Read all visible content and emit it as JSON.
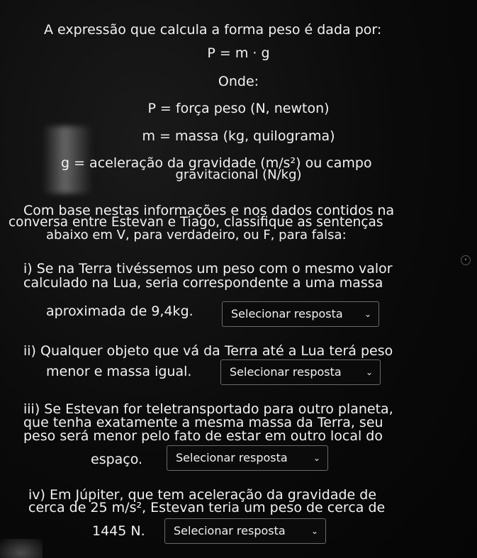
{
  "intro": {
    "heading": "A expressão que calcula a forma peso é dada por:",
    "formula": "P = m · g",
    "onde": "Onde:",
    "def_p": "P = força peso (N, newton)",
    "def_m": "m = massa (kg, quilograma)",
    "def_g_line1": "g = aceleração da gravidade (m/s²) ou campo",
    "def_g_line2": "gravitacional (N/kg)"
  },
  "instructions": {
    "line1": "Com base nestas informações e nos dados contidos na",
    "line2": "conversa entre Estevan e Tiago, classifique as sentenças",
    "line3": "abaixo em V, para verdadeiro, ou F, para falsa:"
  },
  "questions": [
    {
      "lines": [
        "i) Se na Terra tivéssemos um peso com o mesmo valor",
        "calculado na Lua, seria correspondente a uma massa",
        "aproximada de 9,4kg."
      ],
      "select_label": "Selecionar resposta"
    },
    {
      "lines": [
        "ii) Qualquer objeto que vá da Terra até a Lua terá peso",
        "menor e massa igual."
      ],
      "select_label": "Selecionar resposta"
    },
    {
      "lines": [
        "iii) Se Estevan for teletransportado para outro planeta,",
        "que tenha exatamente a mesma massa da Terra, seu",
        "peso será menor pelo fato de estar em outro local do",
        "espaço."
      ],
      "select_label": "Selecionar resposta"
    },
    {
      "lines": [
        "iv) Em Júpiter, que tem aceleração da gravidade de",
        "cerca de 25 m/s², Estevan teria um peso de cerca de",
        "1445 N."
      ],
      "select_label": "Selecionar resposta"
    }
  ],
  "icons": {
    "chevron": "chevron-down-icon"
  }
}
